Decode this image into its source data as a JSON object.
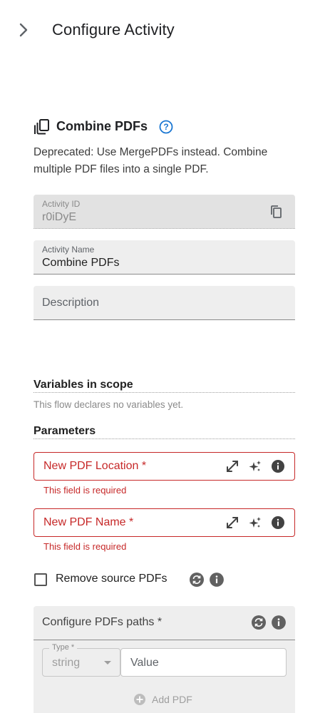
{
  "header": {
    "title": "Configure Activity",
    "expand_icon": "chevron-right-icon"
  },
  "activity": {
    "icon": "copy-stack-icon",
    "name": "Combine PDFs",
    "help_icon": "help-circle-icon",
    "description": "Deprecated: Use MergePDFs instead. Combine multiple PDF files into a single PDF."
  },
  "fields": {
    "activity_id": {
      "label": "Activity ID",
      "value": "r0iDyE",
      "copy_icon": "copy-icon"
    },
    "activity_name": {
      "label": "Activity Name",
      "value": "Combine PDFs"
    },
    "description": {
      "placeholder": "Description"
    }
  },
  "variables": {
    "title": "Variables in scope",
    "empty_text": "This flow declares no variables yet."
  },
  "parameters": {
    "title": "Parameters",
    "new_pdf_location": {
      "label": "New PDF Location *",
      "error": "This field is required"
    },
    "new_pdf_name": {
      "label": "New PDF Name *",
      "error": "This field is required"
    },
    "remove_source": {
      "label": "Remove source PDFs",
      "checked": false
    },
    "pdf_paths": {
      "title": "Configure PDFs paths *",
      "type_label": "Type *",
      "type_value": "string",
      "value_placeholder": "Value",
      "add_label": "Add PDF"
    }
  },
  "colors": {
    "error": "#c62828",
    "help_blue": "#1976d2",
    "field_bg": "#eeeeee"
  }
}
